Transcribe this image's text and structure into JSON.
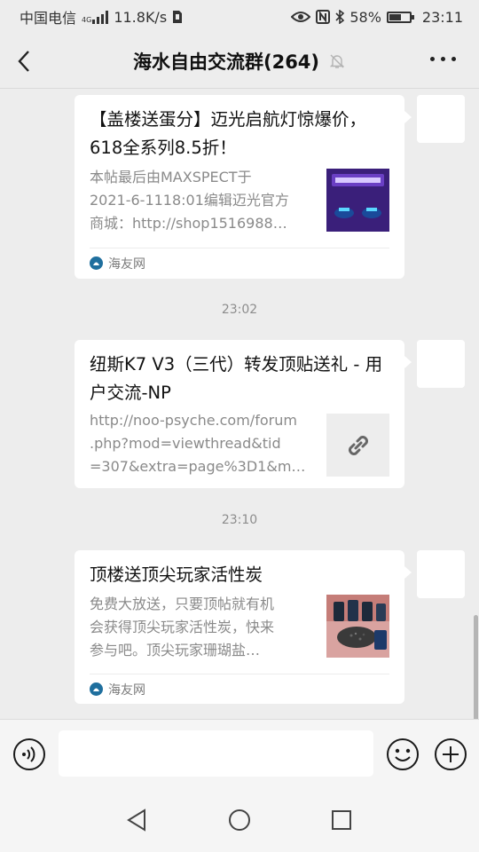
{
  "status_bar": {
    "carrier": "中国电信",
    "net_type": "4G",
    "speed": "11.8K/s",
    "battery_percent": "58%",
    "battery_level": 0.58,
    "time": "23:11",
    "icons": [
      "signal-icon",
      "sim-icon",
      "eye-icon",
      "nfc-icon",
      "bluetooth-icon",
      "battery-icon"
    ]
  },
  "nav": {
    "title": "海水自由交流群(264)",
    "back_icon": "chevron-left-icon",
    "mute_icon": "bell-off-icon",
    "more_icon": "more-dots-icon"
  },
  "messages": [
    {
      "type": "link-card",
      "title": "【盖楼送蛋分】迈光启航灯惊爆价，618全系列8.5折！",
      "desc_lines": [
        "本帖最后由MAXSPECT于",
        "2021-6-1118:01编辑迈光官方",
        "商城：http://shop1516988…"
      ],
      "source": "海友网",
      "thumb": "product-photo"
    },
    {
      "type": "time",
      "text": "23:02"
    },
    {
      "type": "link-card",
      "title": "纽斯K7 V3（三代）转发顶贴送礼 - 用户交流-NP",
      "desc_lines": [
        "http://noo-psyche.com/forum",
        ".php?mod=viewthread&tid",
        "=307&extra=page%3D1&m…"
      ],
      "thumb": "link-icon"
    },
    {
      "type": "time",
      "text": "23:10"
    },
    {
      "type": "link-card",
      "title": "顶楼送顶尖玩家活性炭",
      "desc_lines": [
        "免费大放送，只要顶帖就有机",
        "会获得顶尖玩家活性炭，快来",
        "参与吧。顶尖玩家珊瑚盐…"
      ],
      "source": "海友网",
      "thumb": "carbon-photo"
    }
  ],
  "input_bar": {
    "voice_icon": "voice-icon",
    "emoji_icon": "emoji-icon",
    "plus_icon": "plus-icon"
  },
  "system_nav": [
    "back-triangle-icon",
    "home-circle-icon",
    "recents-square-icon"
  ],
  "colors": {
    "background": "#ededed",
    "card": "#ffffff",
    "source_icon": "#1f6f9e",
    "secondary_text": "#8a8a8a"
  }
}
